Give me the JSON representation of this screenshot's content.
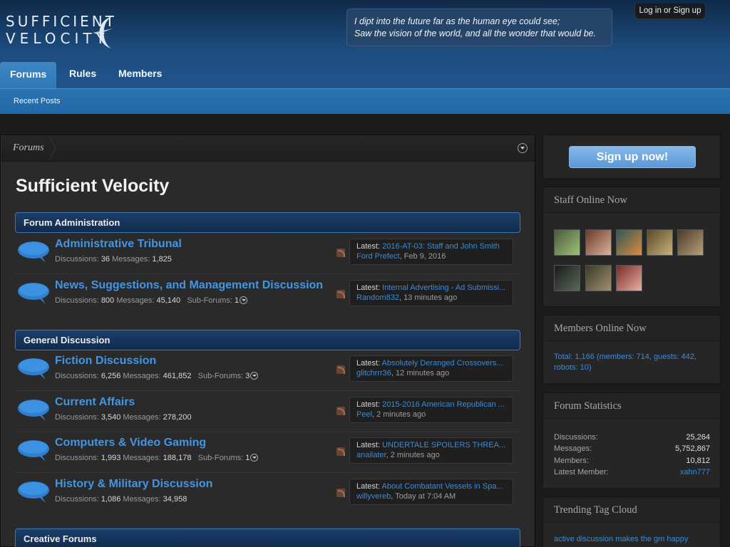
{
  "header": {
    "logo_line1": "SUFFICIENT",
    "logo_line2": "VELOCITY",
    "quote_line1": "I dipt into the future far as the human eye could see;",
    "quote_line2": "Saw the vision of the world, and all the wonder that would be.",
    "login_label": "Log in or Sign up"
  },
  "nav": {
    "tabs": [
      {
        "label": "Forums",
        "selected": true
      },
      {
        "label": "Rules",
        "selected": false
      },
      {
        "label": "Members",
        "selected": false
      }
    ],
    "sub_items": [
      {
        "label": "Recent Posts"
      }
    ]
  },
  "breadcrumb": {
    "items": [
      {
        "label": "Forums"
      }
    ]
  },
  "main": {
    "title": "Sufficient Velocity",
    "categories": [
      {
        "name": "Forum Administration",
        "forums": [
          {
            "title": "Administrative Tribunal",
            "discussions": "36",
            "messages": "1,825",
            "subforums": "",
            "latest_label": "Latest:",
            "latest_thread": "2016-AT-03: Staff and John Smith",
            "latest_user": "Ford Prefect",
            "latest_time": "Feb 9, 2016"
          },
          {
            "title": "News, Suggestions, and Management Discussion",
            "discussions": "800",
            "messages": "45,140",
            "subforums": "1",
            "latest_label": "Latest:",
            "latest_thread": "Internal Advertising - Ad Submissi...",
            "latest_user": "Random832",
            "latest_time": "13 minutes ago"
          }
        ]
      },
      {
        "name": "General Discussion",
        "forums": [
          {
            "title": "Fiction Discussion",
            "discussions": "6,256",
            "messages": "461,852",
            "subforums": "3",
            "latest_label": "Latest:",
            "latest_thread": "Absolutely Deranged Crossovers...",
            "latest_user": "glitchrrr36",
            "latest_time": "12 minutes ago"
          },
          {
            "title": "Current Affairs",
            "discussions": "3,540",
            "messages": "278,200",
            "subforums": "",
            "latest_label": "Latest:",
            "latest_thread": "2015-2016 American Republican ...",
            "latest_user": "Peel",
            "latest_time": "2 minutes ago"
          },
          {
            "title": "Computers & Video Gaming",
            "discussions": "1,993",
            "messages": "188,178",
            "subforums": "1",
            "latest_label": "Latest:",
            "latest_thread": "UNDERTALE SPOILERS THREA...",
            "latest_user": "anailater",
            "latest_time": "2 minutes ago"
          },
          {
            "title": "History & Military Discussion",
            "discussions": "1,086",
            "messages": "34,958",
            "subforums": "",
            "latest_label": "Latest:",
            "latest_thread": "About Combatant Vessels in Spa...",
            "latest_user": "willyvereb",
            "latest_time": "Today at 7:04 AM"
          }
        ]
      },
      {
        "name": "Creative Forums",
        "forums": []
      }
    ],
    "labels": {
      "discussions": "Discussions:",
      "messages": "Messages:",
      "subforums": "Sub-Forums:"
    }
  },
  "sidebar": {
    "signup_label": "Sign up now!",
    "staff_heading": "Staff Online Now",
    "staff_avatars": [
      {
        "icon": "avatar-green-creature"
      },
      {
        "icon": "avatar-anime-boy"
      },
      {
        "icon": "avatar-fighter"
      },
      {
        "icon": "avatar-sepia-figure"
      },
      {
        "icon": "avatar-sepia-portrait"
      },
      {
        "icon": "avatar-armored-soldier"
      },
      {
        "icon": "avatar-soldier"
      },
      {
        "icon": "avatar-redhead"
      }
    ],
    "members_heading": "Members Online Now",
    "members_text": "Total: 1,166 (members: 714, guests: 442, robots: 10)",
    "stats_heading": "Forum Statistics",
    "stats": [
      {
        "label": "Discussions:",
        "value": "25,264"
      },
      {
        "label": "Messages:",
        "value": "5,752,867"
      },
      {
        "label": "Members:",
        "value": "10,812"
      },
      {
        "label": "Latest Member:",
        "value": "xahn777"
      }
    ],
    "tags_heading": "Trending Tag Cloud",
    "tags_text": "active discussion makes the gm happy"
  },
  "colors": {
    "accent_blue": "#4296e3",
    "link_blue": "#3d8ad6",
    "header_blue": "#225a93",
    "background": "#1b1b1b"
  }
}
